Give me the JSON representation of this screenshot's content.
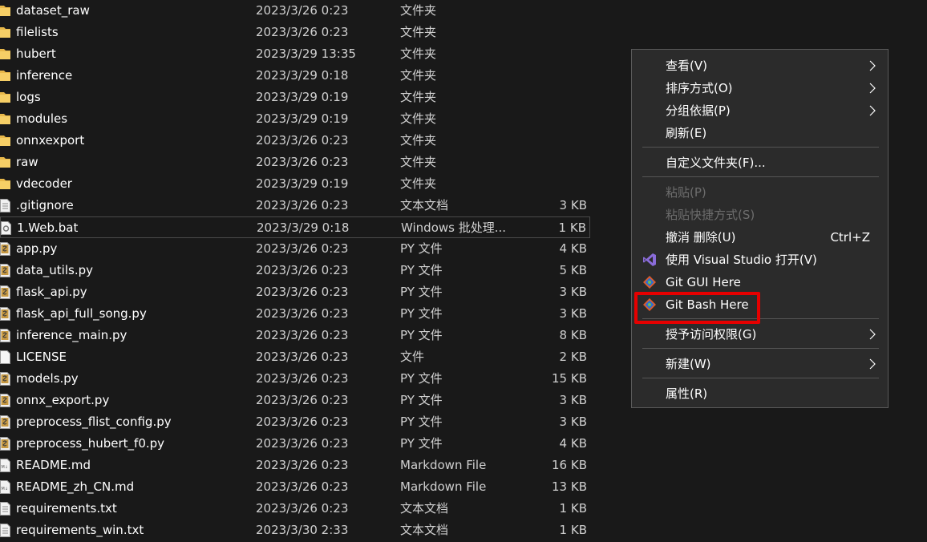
{
  "files": [
    {
      "name": "dataset_raw",
      "date": "2023/3/26 0:23",
      "type": "文件夹",
      "size": "",
      "icon": "folder-icon"
    },
    {
      "name": "filelists",
      "date": "2023/3/26 0:23",
      "type": "文件夹",
      "size": "",
      "icon": "folder-icon"
    },
    {
      "name": "hubert",
      "date": "2023/3/29 13:35",
      "type": "文件夹",
      "size": "",
      "icon": "folder-icon"
    },
    {
      "name": "inference",
      "date": "2023/3/29 0:18",
      "type": "文件夹",
      "size": "",
      "icon": "folder-icon"
    },
    {
      "name": "logs",
      "date": "2023/3/29 0:19",
      "type": "文件夹",
      "size": "",
      "icon": "folder-icon"
    },
    {
      "name": "modules",
      "date": "2023/3/29 0:19",
      "type": "文件夹",
      "size": "",
      "icon": "folder-icon"
    },
    {
      "name": "onnxexport",
      "date": "2023/3/26 0:23",
      "type": "文件夹",
      "size": "",
      "icon": "folder-icon"
    },
    {
      "name": "raw",
      "date": "2023/3/26 0:23",
      "type": "文件夹",
      "size": "",
      "icon": "folder-icon"
    },
    {
      "name": "vdecoder",
      "date": "2023/3/29 0:19",
      "type": "文件夹",
      "size": "",
      "icon": "folder-icon"
    },
    {
      "name": ".gitignore",
      "date": "2023/3/26 0:23",
      "type": "文本文档",
      "size": "3 KB",
      "icon": "text-file-icon"
    },
    {
      "name": "1.Web.bat",
      "date": "2023/3/29 0:18",
      "type": "Windows 批处理...",
      "size": "1 KB",
      "icon": "batch-file-icon"
    },
    {
      "name": "app.py",
      "date": "2023/3/26 0:23",
      "type": "PY 文件",
      "size": "4 KB",
      "icon": "python-file-icon"
    },
    {
      "name": "data_utils.py",
      "date": "2023/3/26 0:23",
      "type": "PY 文件",
      "size": "5 KB",
      "icon": "python-file-icon"
    },
    {
      "name": "flask_api.py",
      "date": "2023/3/26 0:23",
      "type": "PY 文件",
      "size": "3 KB",
      "icon": "python-file-icon"
    },
    {
      "name": "flask_api_full_song.py",
      "date": "2023/3/26 0:23",
      "type": "PY 文件",
      "size": "3 KB",
      "icon": "python-file-icon"
    },
    {
      "name": "inference_main.py",
      "date": "2023/3/26 0:23",
      "type": "PY 文件",
      "size": "8 KB",
      "icon": "python-file-icon"
    },
    {
      "name": "LICENSE",
      "date": "2023/3/26 0:23",
      "type": "文件",
      "size": "2 KB",
      "icon": "blank-file-icon"
    },
    {
      "name": "models.py",
      "date": "2023/3/26 0:23",
      "type": "PY 文件",
      "size": "15 KB",
      "icon": "python-file-icon"
    },
    {
      "name": "onnx_export.py",
      "date": "2023/3/26 0:23",
      "type": "PY 文件",
      "size": "3 KB",
      "icon": "python-file-icon"
    },
    {
      "name": "preprocess_flist_config.py",
      "date": "2023/3/26 0:23",
      "type": "PY 文件",
      "size": "3 KB",
      "icon": "python-file-icon"
    },
    {
      "name": "preprocess_hubert_f0.py",
      "date": "2023/3/26 0:23",
      "type": "PY 文件",
      "size": "4 KB",
      "icon": "python-file-icon"
    },
    {
      "name": "README.md",
      "date": "2023/3/26 0:23",
      "type": "Markdown File",
      "size": "16 KB",
      "icon": "markdown-file-icon"
    },
    {
      "name": "README_zh_CN.md",
      "date": "2023/3/26 0:23",
      "type": "Markdown File",
      "size": "13 KB",
      "icon": "markdown-file-icon"
    },
    {
      "name": "requirements.txt",
      "date": "2023/3/26 0:23",
      "type": "文本文档",
      "size": "1 KB",
      "icon": "text-file-icon"
    },
    {
      "name": "requirements_win.txt",
      "date": "2023/3/30 2:33",
      "type": "文本文档",
      "size": "1 KB",
      "icon": "text-file-icon"
    }
  ],
  "context_menu": {
    "items": [
      {
        "label": "查看(V)",
        "submenu": true
      },
      {
        "label": "排序方式(O)",
        "submenu": true
      },
      {
        "label": "分组依据(P)",
        "submenu": true
      },
      {
        "label": "刷新(E)"
      },
      {
        "label": "自定义文件夹(F)..."
      },
      {
        "label": "粘贴(P)",
        "disabled": true
      },
      {
        "label": "粘贴快捷方式(S)",
        "disabled": true
      },
      {
        "label": "撤消 删除(U)",
        "shortcut": "Ctrl+Z"
      },
      {
        "label": "使用 Visual Studio 打开(V)",
        "icon": "visual-studio-icon"
      },
      {
        "label": "Git GUI Here",
        "icon": "git-icon"
      },
      {
        "label": "Git Bash Here",
        "icon": "git-icon"
      },
      {
        "label": "授予访问权限(G)",
        "submenu": true
      },
      {
        "label": "新建(W)",
        "submenu": true
      },
      {
        "label": "属性(R)"
      }
    ]
  },
  "colors": {
    "background": "#191919",
    "menu_bg": "#2b2b2b",
    "highlight": "#e60000",
    "folder": "#e8b84a"
  }
}
